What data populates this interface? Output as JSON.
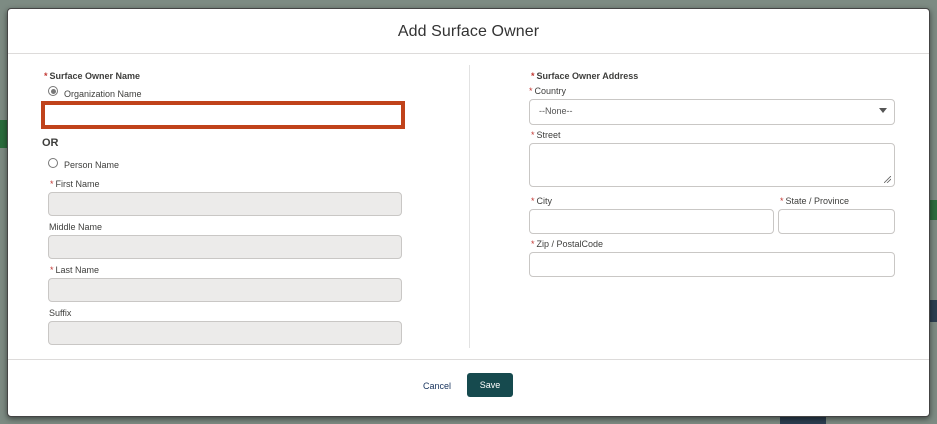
{
  "modal": {
    "title": "Add Surface Owner"
  },
  "owner_name": {
    "section_label": "Surface Owner Name",
    "organization_option": "Organization Name",
    "organization_value": "",
    "or_text": "OR",
    "person_option": "Person Name",
    "first_name_label": "First Name",
    "middle_name_label": "Middle Name",
    "last_name_label": "Last Name",
    "suffix_label": "Suffix",
    "selected_option": "Organization Name"
  },
  "address": {
    "section_label": "Surface Owner Address",
    "country_label": "Country",
    "country_value": "--None--",
    "street_label": "Street",
    "city_label": "City",
    "state_label": "State / Province",
    "zip_label": "Zip / PostalCode"
  },
  "footer": {
    "cancel_label": "Cancel",
    "save_label": "Save"
  },
  "colors": {
    "save_button": "#164a4e",
    "highlight_border": "#c0421a",
    "required_asterisk": "#c23934"
  },
  "icons": {
    "country_dropdown": "chevron-down-icon",
    "street_resize": "resize-handle-icon"
  }
}
